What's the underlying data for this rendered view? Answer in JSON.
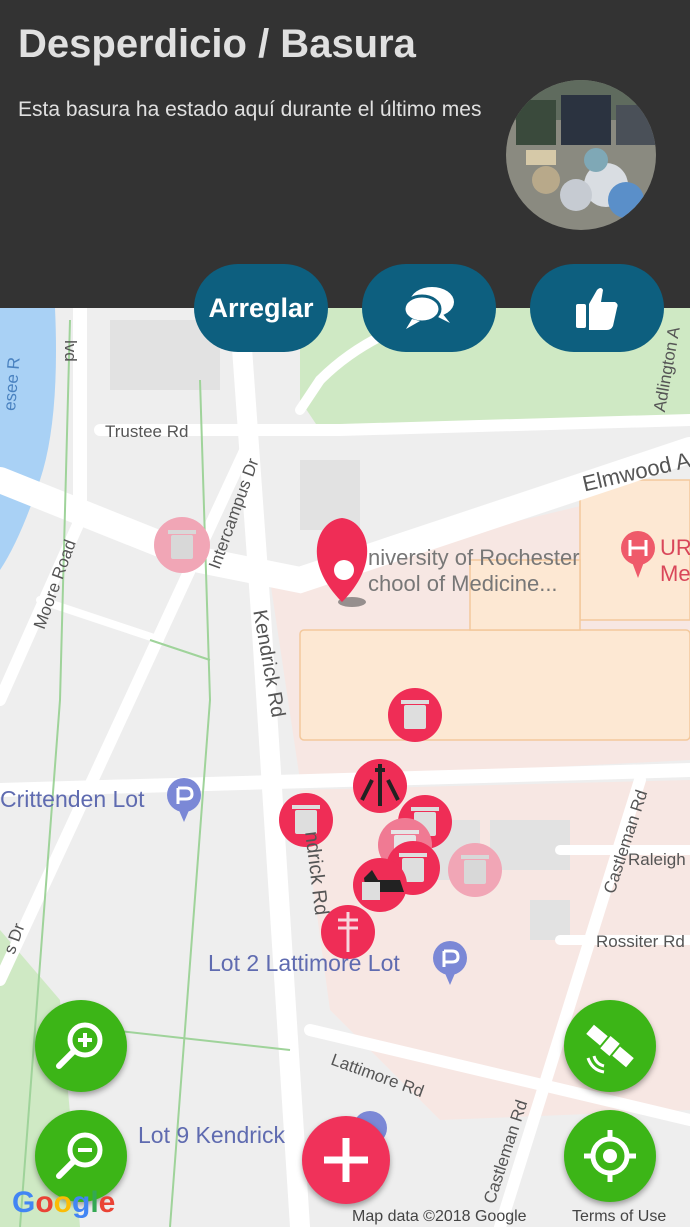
{
  "header": {
    "title": "Desperdicio / Basura",
    "description": "Esta basura ha estado aquí durante el último mes",
    "photo_icon": "trash-pile-photo"
  },
  "actions": {
    "fix_label": "Arreglar",
    "comment_icon": "chat-bubbles-icon",
    "like_icon": "thumbs-up-icon"
  },
  "map": {
    "places": {
      "crittenden": "Crittenden Lot",
      "lot2": "Lot 2 Lattimore Lot",
      "lot9": "Lot 9 Kendrick",
      "school_line1": "niversity of Rochester",
      "school_line2": "chool of Medicine...",
      "hospital_line1": "UR",
      "hospital_line2": "Me"
    },
    "roads": {
      "trustee": "Trustee Rd",
      "elmwood": "Elmwood A",
      "intercampus": "Intercampus Dr",
      "kendrick": "Kendrick Rd",
      "kendrick2": "ndrick Rd",
      "moore": "Moore Road",
      "castleman": "Castleman Rd",
      "castleman2": "Castleman Rd",
      "raleigh": "Raleigh",
      "rossiter": "Rossiter Rd",
      "lattimore": "Lattimore Rd",
      "adlington": "Adlington A",
      "blvd": "lvd",
      "genesee": "esee R",
      "dr": "s Dr"
    },
    "attribution": "Map data ©2018 Google",
    "terms": "Terms of Use",
    "google_logo": "Google",
    "accent_red": "#f0325a",
    "green": "#3cb517",
    "blue": "#0d5f7f"
  },
  "controls": {
    "zoom_in_icon": "zoom-in-icon",
    "zoom_out_icon": "zoom-out-icon",
    "satellite_icon": "satellite-icon",
    "locate_icon": "crosshair-icon",
    "add_icon": "plus-icon"
  }
}
